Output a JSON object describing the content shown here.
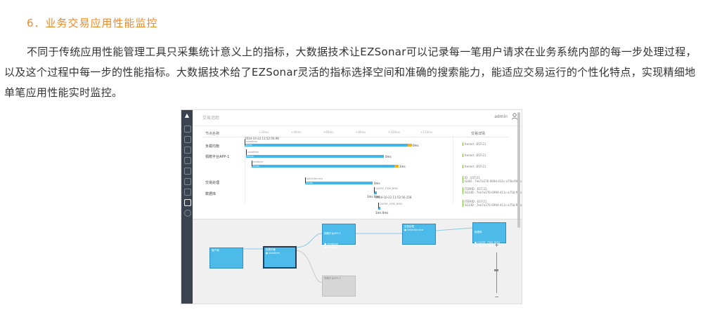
{
  "section": {
    "heading": "6．业务交易应用性能监控",
    "paragraph": "不同于传统应用性能管理工具只采集统计意义上的指标，大数据技术让EZSonar可以记录每一笔用户请求在业务系统内部的每一步处理过程，以及这个过程中每一步的性能指标。大数据技术给了EZSonar灵活的指标选择空间和准确的搜索能力，能适应交易运行的个性化特点，实现精细地单笔应用性能实时监控。"
  },
  "screenshot": {
    "title": "交易追踪",
    "user": "admin",
    "header": {
      "name": "节点名称",
      "detail": "交易详情"
    },
    "ticks": [
      "+20ms",
      "+40ms",
      "+60ms",
      "+80ms",
      "+100ms",
      "+120ms"
    ],
    "time_start": "2014-10-22 11:52:56.98",
    "time_end": "2014-10-22 11:52:56.158",
    "rows": [
      {
        "label": "负载均衡",
        "bar_label": "viewItem",
        "bar_text": "20ms",
        "cap": "0ms"
      },
      {
        "label": "捐赠平台APP-1",
        "bar_label": "viewItem",
        "bar_text": "20ms",
        "cap": "0ms"
      },
      {
        "label": "",
        "bar_label": "viewItem",
        "bar_text": "20ms",
        "cap": "1ms"
      },
      {
        "label": "交易处理",
        "bar_label": "SellerService",
        "bar_text": "20ms",
        "cap": "0ms"
      },
      {
        "label": "数据库",
        "bar_label": "QUERY_ITEM_BYID",
        "bar_text": "",
        "cap": "1ms 0ms"
      },
      {
        "label": "",
        "bar_label": "QUERY_ITEM_BYID",
        "bar_text": "",
        "cap": "1ms 0ms"
      }
    ],
    "details": [
      "ItemId : EST-21",
      "ItemId : EST-21",
      "ItemId : EST-21",
      "ID : EST-21\nGUID : 7ee7e276-069d-411c-a75b-f0bacad4f182",
      "ITEMID : EST-21\nSGUID : 7ee7e276-6994-411c-a75b-f0bacad4f182",
      "ITEMID : EST-21\nSGUID : 7ee7e276-6994-411c-a75b-f0bacad4f182"
    ],
    "flow_nodes": [
      {
        "title": "客户端",
        "body": ""
      },
      {
        "title": "负载均衡",
        "body": "● viewItem"
      },
      {
        "title": "捐赠平台APP-1",
        "body": "● viewItem\n● viewItem"
      },
      {
        "title": "交易处理",
        "body": "● SellerService"
      },
      {
        "title": "数据库",
        "body": "● QUERY_ITEM_BYID\n● QUERY_ITEM_BYID"
      },
      {
        "title": "捐赠平台APP-2",
        "body": ""
      }
    ],
    "zoom": {
      "plus": "+",
      "minus": "−"
    }
  },
  "colors": {
    "heading": "#f08a24",
    "bar": "#3fb5ea",
    "bar_end": "#f5b021",
    "sidebar": "#3b4350"
  }
}
